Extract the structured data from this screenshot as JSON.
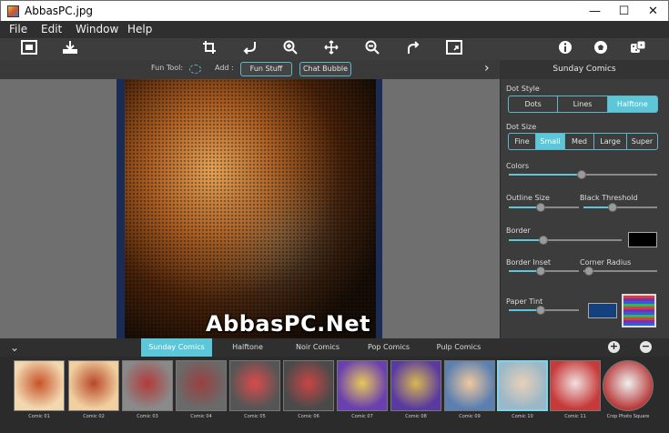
{
  "window": {
    "title": "AbbasPC.jpg",
    "minimize": "—",
    "maximize": "☐",
    "close": "✕"
  },
  "menu": [
    "File",
    "Edit",
    "Window",
    "Help"
  ],
  "toolbar": {
    "icons": [
      "open-image-icon",
      "save-icon",
      "crop-icon",
      "undo-icon",
      "zoom-in-icon",
      "move-icon",
      "zoom-out-icon",
      "redo-icon",
      "fit-image-icon",
      "info-icon",
      "soccer-ball-icon",
      "dice-icon"
    ]
  },
  "funbar": {
    "fun_tool_label": "Fun Tool:",
    "add_label": "Add :",
    "fun_stuff": "Fun Stuff",
    "chat_bubble": "Chat Bubble"
  },
  "canvas": {
    "watermark": "AbbasPC.Net"
  },
  "panel": {
    "title": "Sunday Comics",
    "dot_style_label": "Dot Style",
    "dot_styles": [
      "Dots",
      "Lines",
      "Halftone"
    ],
    "dot_style_selected": "Halftone",
    "dot_size_label": "Dot Size",
    "dot_sizes": [
      "Fine",
      "Small",
      "Med",
      "Large",
      "Super"
    ],
    "dot_size_selected": "Small",
    "colors_label": "Colors",
    "colors_value": 0.49,
    "outline_size_label": "Outline Size",
    "outline_size_value": 0.46,
    "black_threshold_label": "Black Threshold",
    "black_threshold_value": 0.4,
    "border_label": "Border",
    "border_value": 0.31,
    "border_color": "#000000",
    "border_inset_label": "Border Inset",
    "border_inset_value": 0.46,
    "corner_radius_label": "Corner Radius",
    "corner_radius_value": 0.08,
    "paper_tint_label": "Paper Tint",
    "paper_tint_value": 0.46,
    "paper_tint_color": "#15407e",
    "accent": "#5bc7d8"
  },
  "tabs": [
    "Sunday Comics",
    "Halftone",
    "Noir Comics",
    "Pop Comics",
    "Pulp Comics"
  ],
  "tab_selected": "Sunday Comics",
  "thumbnails": [
    {
      "label": "Comic 01",
      "colors": [
        "#f2d8b0",
        "#c8532a"
      ]
    },
    {
      "label": "Comic 02",
      "colors": [
        "#f0d0a0",
        "#b8482a"
      ]
    },
    {
      "label": "Comic 03",
      "colors": [
        "#8a8a8a",
        "#b33a3a"
      ]
    },
    {
      "label": "Comic 04",
      "colors": [
        "#6a6a6a",
        "#9a4040"
      ]
    },
    {
      "label": "Comic 05",
      "colors": [
        "#555555",
        "#d94b4b"
      ]
    },
    {
      "label": "Comic 06",
      "colors": [
        "#4a4a4a",
        "#c84545"
      ]
    },
    {
      "label": "Comic 07",
      "colors": [
        "#6a3fb0",
        "#e8c85a"
      ]
    },
    {
      "label": "Comic 08",
      "colors": [
        "#5a3aa0",
        "#d8b850"
      ]
    },
    {
      "label": "Comic 09",
      "colors": [
        "#5a7fb0",
        "#f0c8a0"
      ]
    },
    {
      "label": "Comic 10",
      "colors": [
        "#9ab8c8",
        "#e8d0b8"
      ]
    },
    {
      "label": "Comic 11",
      "colors": [
        "#c83a3a",
        "#f0e0e0"
      ]
    },
    {
      "label": "Crop Photo Square",
      "colors": [
        "#b83a3a",
        "#f0f0f0"
      ]
    }
  ]
}
